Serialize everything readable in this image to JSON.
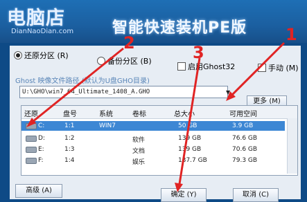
{
  "header": {
    "logo_main": "电脑店",
    "logo_sub": "DianNaoDian.com",
    "title": "智能快速装机PE版"
  },
  "options": {
    "restore": "还原分区 (R)",
    "backup": "备份分区 (B)",
    "ghost32": "启用Ghost32",
    "manual": "手动 (M)"
  },
  "path": {
    "label": "Ghost 映像文件路径 (默认为U盘GHO目录)",
    "value": "U:\\GHO\\win7_64_Ultimate_1408_A.GHO",
    "more_button": "更多 (M)"
  },
  "table": {
    "headers": [
      "还原",
      "盘号",
      "系统",
      "卷标",
      "总大小",
      "可用空间"
    ],
    "rows": [
      {
        "drive": "C:",
        "disk": "1:1",
        "system": "WIN7",
        "label": "",
        "total": "50 GB",
        "free": "3.9 GB"
      },
      {
        "drive": "D:",
        "disk": "1:2",
        "system": "",
        "label": "软件",
        "total": "139 GB",
        "free": "76.6 GB"
      },
      {
        "drive": "E:",
        "disk": "1:3",
        "system": "",
        "label": "文档",
        "total": "139 GB",
        "free": "70.6 GB"
      },
      {
        "drive": "F:",
        "disk": "1:4",
        "system": "",
        "label": "娱乐",
        "total": "137.7 GB",
        "free": "79.3 GB"
      }
    ]
  },
  "buttons": {
    "advanced": "高级 (A)",
    "ok": "确定 (Y)",
    "cancel": "取消 (C)"
  },
  "annotations": [
    "1",
    "2",
    "3"
  ],
  "colors": {
    "selection": "#3d87d4",
    "annotation": "#e02424"
  }
}
